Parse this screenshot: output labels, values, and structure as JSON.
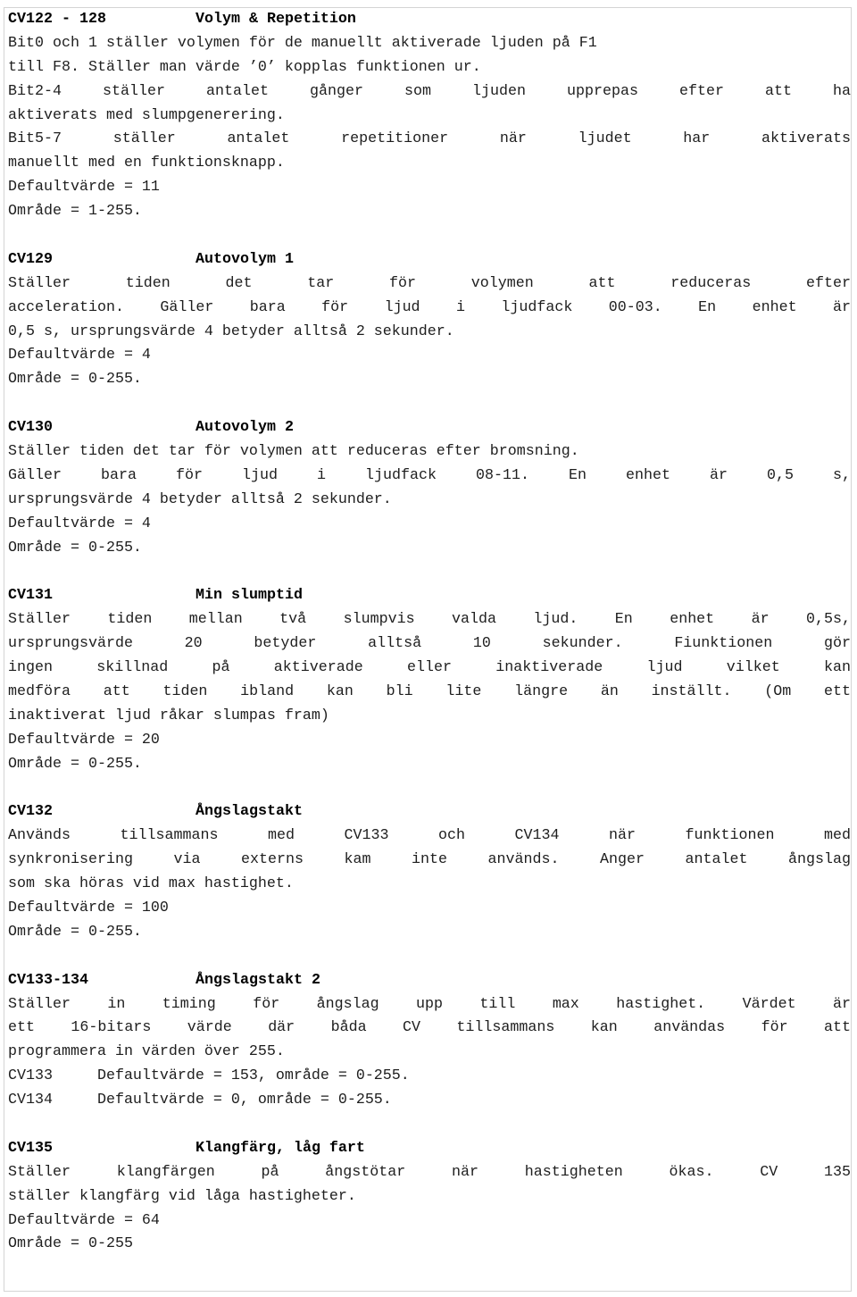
{
  "sections": [
    {
      "cv": "CV122 - 128",
      "title": "Volym & Repetition",
      "lines": [
        {
          "text": "Bit0 och 1 ställer volymen för de manuellt aktiverade ljuden på F1",
          "justify": false
        },
        {
          "text": "till F8. Ställer man värde ’0’ kopplas funktionen ur.",
          "justify": false
        },
        {
          "text": "Bit2-4 ställer antalet gånger som ljuden upprepas efter att ha",
          "justify": true
        },
        {
          "text": "aktiverats med slumpgenerering.",
          "justify": false
        },
        {
          "text": "Bit5-7 ställer antalet repetitioner när ljudet har aktiverats",
          "justify": true
        },
        {
          "text": "manuellt med en funktionsknapp.",
          "justify": false
        },
        {
          "text": "Defaultvärde = 11",
          "justify": false
        },
        {
          "text": "Område = 1-255.",
          "justify": false
        }
      ]
    },
    {
      "cv": "CV129",
      "title": "Autovolym 1",
      "lines": [
        {
          "text": "Ställer tiden det tar för volymen att reduceras efter",
          "justify": true
        },
        {
          "text": "acceleration. Gäller bara för ljud i ljudfack 00-03. En enhet är",
          "justify": true
        },
        {
          "text": "0,5 s, ursprungsvärde 4 betyder alltså 2 sekunder.",
          "justify": false
        },
        {
          "text": "Defaultvärde = 4",
          "justify": false
        },
        {
          "text": "Område = 0-255.",
          "justify": false
        }
      ]
    },
    {
      "cv": "CV130",
      "title": "Autovolym 2",
      "lines": [
        {
          "text": "Ställer tiden det tar för volymen att reduceras efter bromsning.",
          "justify": false
        },
        {
          "text": "Gäller bara för ljud i ljudfack 08-11. En enhet är 0,5 s,",
          "justify": true
        },
        {
          "text": "ursprungsvärde 4 betyder alltså 2 sekunder.",
          "justify": false
        },
        {
          "text": "Defaultvärde = 4",
          "justify": false
        },
        {
          "text": "Område = 0-255.",
          "justify": false
        }
      ]
    },
    {
      "cv": "CV131",
      "title": "Min slumptid",
      "lines": [
        {
          "text": "Ställer tiden mellan två slumpvis valda ljud. En enhet är 0,5s,",
          "justify": true
        },
        {
          "text": "ursprungsvärde 20 betyder alltså 10 sekunder. Fiunktionen gör",
          "justify": true
        },
        {
          "text": "ingen skillnad på aktiverade eller inaktiverade ljud vilket kan",
          "justify": true
        },
        {
          "text": "medföra att tiden ibland kan bli lite längre än inställt. (Om ett",
          "justify": true
        },
        {
          "text": "inaktiverat ljud råkar slumpas fram)",
          "justify": false
        },
        {
          "text": "Defaultvärde = 20",
          "justify": false
        },
        {
          "text": "Område = 0-255.",
          "justify": false
        }
      ]
    },
    {
      "cv": "CV132",
      "title": "Ångslagstakt",
      "lines": [
        {
          "text": "Används tillsammans med CV133 och CV134 när funktionen med",
          "justify": true
        },
        {
          "text": "synkronisering via externs kam inte används. Anger antalet ångslag",
          "justify": true
        },
        {
          "text": "som ska höras vid max hastighet.",
          "justify": false
        },
        {
          "text": "Defaultvärde = 100",
          "justify": false
        },
        {
          "text": "Område = 0-255.",
          "justify": false
        }
      ]
    },
    {
      "cv": "CV133-134",
      "title": "Ångslagstakt 2",
      "lines": [
        {
          "text": "Ställer in timing för ångslag upp till max hastighet. Värdet är",
          "justify": true
        },
        {
          "text": "ett 16-bitars värde där båda CV tillsammans kan användas för att",
          "justify": true
        },
        {
          "text": "programmera in värden över 255.",
          "justify": false
        },
        {
          "text": "CV133     Defaultvärde = 153, område = 0-255.",
          "justify": false
        },
        {
          "text": "CV134     Defaultvärde = 0, område = 0-255.",
          "justify": false
        }
      ]
    },
    {
      "cv": "CV135",
      "title": "Klangfärg, låg fart",
      "lines": [
        {
          "text": "Ställer klangfärgen på ångstötar när hastigheten ökas. CV 135",
          "justify": true
        },
        {
          "text": "ställer klangfärg vid låga hastigheter.",
          "justify": false
        },
        {
          "text": "Defaultvärde = 64",
          "justify": false
        },
        {
          "text": "Område = 0-255",
          "justify": false
        }
      ]
    }
  ]
}
